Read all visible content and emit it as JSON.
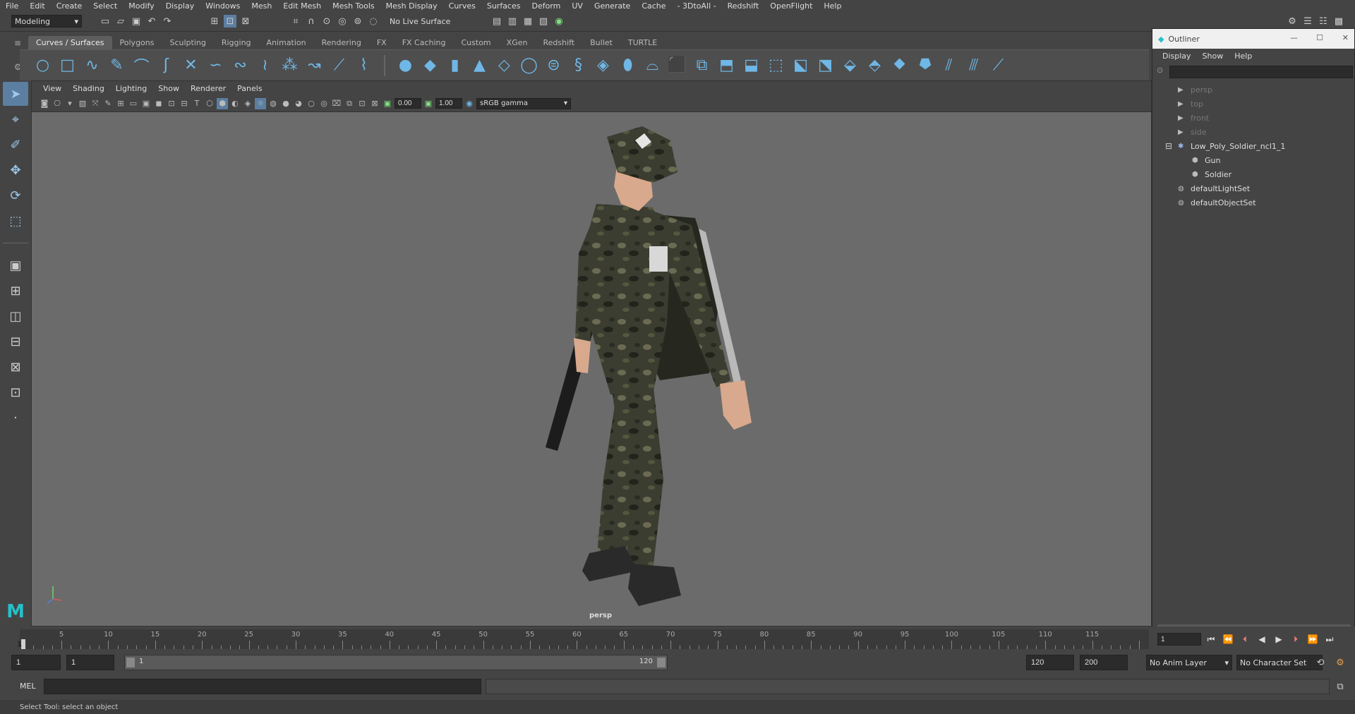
{
  "menubar": [
    "File",
    "Edit",
    "Create",
    "Select",
    "Modify",
    "Display",
    "Windows",
    "Mesh",
    "Edit Mesh",
    "Mesh Tools",
    "Mesh Display",
    "Curves",
    "Surfaces",
    "Deform",
    "UV",
    "Generate",
    "Cache",
    "- 3DtoAll -",
    "Redshift",
    "OpenFlight",
    "Help"
  ],
  "statusline": {
    "workspace": "Modeling",
    "live_surface": "No Live Surface"
  },
  "shelf_tabs": [
    "Curves / Surfaces",
    "Polygons",
    "Sculpting",
    "Rigging",
    "Animation",
    "Rendering",
    "FX",
    "FX Caching",
    "Custom",
    "XGen",
    "Redshift",
    "Bullet",
    "TURTLE"
  ],
  "active_shelf_tab": "Curves / Surfaces",
  "viewport": {
    "panel_menu": [
      "View",
      "Shading",
      "Lighting",
      "Show",
      "Renderer",
      "Panels"
    ],
    "exposure": "0.00",
    "gamma": "1.00",
    "color_space": "sRGB gamma",
    "camera_label": "persp"
  },
  "outliner": {
    "title": "Outliner",
    "menu": [
      "Display",
      "Show",
      "Help"
    ],
    "items": [
      {
        "label": "persp",
        "type": "camera",
        "dim": true
      },
      {
        "label": "top",
        "type": "camera",
        "dim": true
      },
      {
        "label": "front",
        "type": "camera",
        "dim": true
      },
      {
        "label": "side",
        "type": "camera",
        "dim": true
      },
      {
        "label": "Low_Poly_Soldier_ncl1_1",
        "type": "group",
        "dim": false
      },
      {
        "label": "Gun",
        "type": "mesh",
        "dim": false
      },
      {
        "label": "Soldier",
        "type": "mesh",
        "dim": false
      },
      {
        "label": "defaultLightSet",
        "type": "set",
        "dim": false
      },
      {
        "label": "defaultObjectSet",
        "type": "set",
        "dim": false
      }
    ]
  },
  "timeline": {
    "ticks": [
      "5",
      "10",
      "15",
      "20",
      "25",
      "30",
      "35",
      "40",
      "45",
      "50",
      "55",
      "60",
      "65",
      "70",
      "75",
      "80",
      "85",
      "90",
      "95",
      "100",
      "105",
      "110",
      "115"
    ],
    "start_label": "1",
    "current_frame": "1"
  },
  "range": {
    "start": "1",
    "playback_start": "1",
    "slider_start": "1",
    "slider_end": "120",
    "playback_end": "120",
    "end": "200",
    "anim_layer": "No Anim Layer",
    "character_set": "No Character Set"
  },
  "cmdline": {
    "language": "MEL"
  },
  "helpline": "Select Tool: select an object"
}
